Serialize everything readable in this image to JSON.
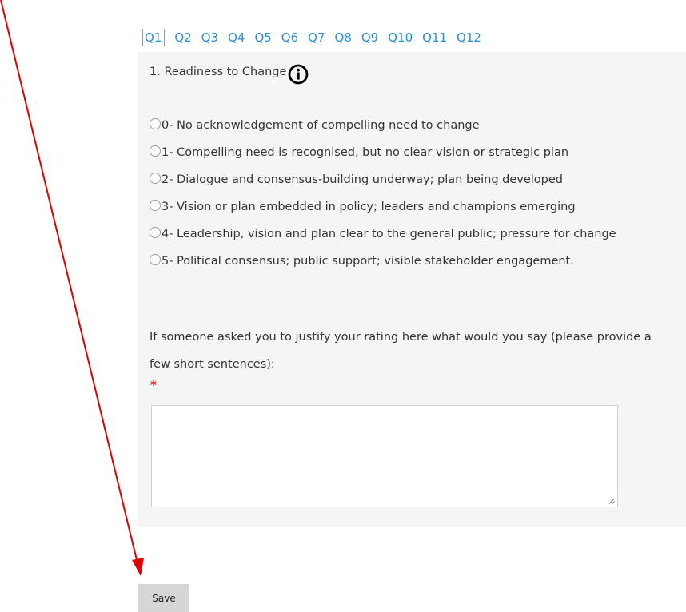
{
  "tabs": [
    "Q1",
    "Q2",
    "Q3",
    "Q4",
    "Q5",
    "Q6",
    "Q7",
    "Q8",
    "Q9",
    "Q10",
    "Q11",
    "Q12"
  ],
  "active_tab": "Q1",
  "question": {
    "title": "1. Readiness to Change",
    "info_icon": "info-circle-icon",
    "options": [
      "0- No acknowledgement of compelling need to change",
      "1- Compelling need is recognised, but no clear vision or strategic plan",
      "2- Dialogue and consensus-building underway; plan being developed",
      "3- Vision or plan embedded in policy; leaders and champions emerging",
      "4- Leadership, vision and plan clear to the general public; pressure for change",
      "5- Political consensus; public support; visible stakeholder engagement."
    ],
    "justify_prompt": "If someone asked you to justify your rating here what would you say (please provide a few short sentences):",
    "required_marker": "*",
    "textarea_value": ""
  },
  "save_label": "Save",
  "annotation": {
    "arrow_color": "#e00000"
  },
  "colors": {
    "tab_link": "#2a8fd8",
    "panel_bg": "#f5f5f5",
    "required": "#e03030",
    "button_bg": "#d6d6d6"
  }
}
